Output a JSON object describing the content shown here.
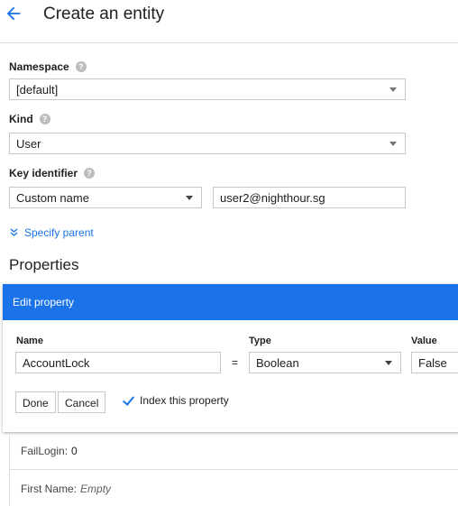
{
  "header": {
    "title": "Create an entity"
  },
  "form": {
    "namespace": {
      "label": "Namespace",
      "value": "[default]"
    },
    "kind": {
      "label": "Kind",
      "value": "User"
    },
    "key_identifier": {
      "label": "Key identifier",
      "type": "Custom name",
      "value": "user2@nighthour.sg"
    },
    "specify_parent": "Specify parent"
  },
  "properties": {
    "title": "Properties",
    "editor": {
      "title": "Edit property",
      "name_label": "Name",
      "type_label": "Type",
      "value_label": "Value",
      "name": "AccountLock",
      "equals": "=",
      "type": "Boolean",
      "value": "False",
      "done": "Done",
      "cancel": "Cancel",
      "index_label": "Index this property",
      "index_checked": true
    },
    "list": [
      {
        "name": "FailLogin:",
        "value": "0",
        "empty": false
      },
      {
        "name": "First Name:",
        "value": "Empty",
        "empty": true
      }
    ]
  },
  "colors": {
    "accent": "#1a73e8"
  }
}
